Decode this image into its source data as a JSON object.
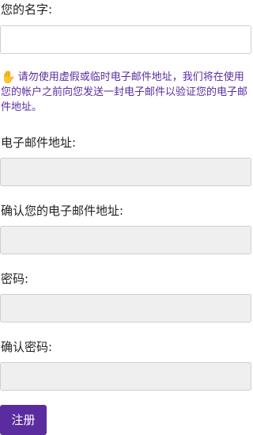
{
  "form": {
    "name_label": "您的名字:",
    "name_value": "",
    "notice_icon": "raised-hand-icon",
    "notice_text": "请勿使用虚假或临时电子邮件地址，我们将在使用您的帐户之前向您发送一封电子邮件以验证您的电子邮件地址。",
    "email_label": "电子邮件地址:",
    "email_value": "",
    "email_confirm_label": "确认您的电子邮件地址:",
    "email_confirm_value": "",
    "password_label": "密码:",
    "password_value": "",
    "password_confirm_label": "确认密码:",
    "password_confirm_value": "",
    "submit_label": "注册"
  },
  "colors": {
    "accent": "#5b2ca0",
    "disabled_field": "#efefef",
    "border": "#cfcfcf"
  }
}
